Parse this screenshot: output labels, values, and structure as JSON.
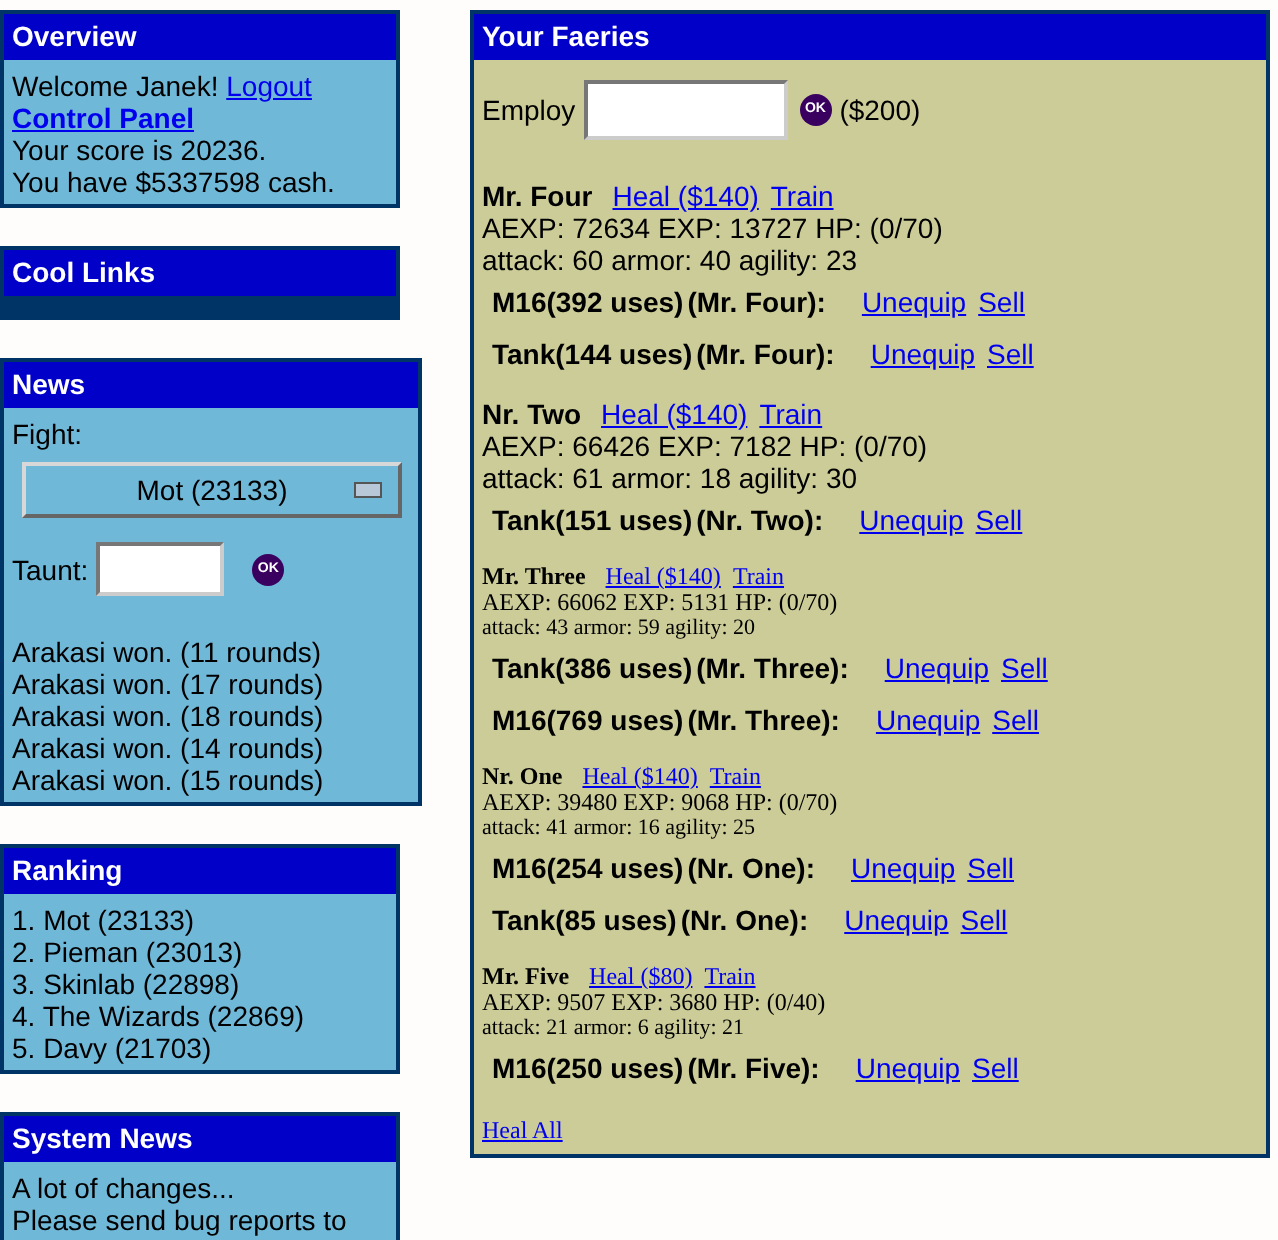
{
  "overview": {
    "title": "Overview",
    "welcome": "Welcome Janek!",
    "logout": "Logout",
    "control_panel": "Control Panel",
    "score": "Your score is 20236.",
    "cash": "You have $5337598 cash."
  },
  "cool_links": {
    "title": "Cool Links"
  },
  "news": {
    "title": "News",
    "fight_label": "Fight:",
    "fight_select": "Mot (23133)",
    "taunt_label": "Taunt:",
    "ok": "OK",
    "results": [
      "Arakasi won. (11 rounds)",
      "Arakasi won. (17 rounds)",
      "Arakasi won. (18 rounds)",
      "Arakasi won. (14 rounds)",
      "Arakasi won. (15 rounds)"
    ]
  },
  "ranking": {
    "title": "Ranking",
    "items": [
      "1. Mot (23133)",
      "2. Pieman (23013)",
      "3. Skinlab (22898)",
      "4. The Wizards (22869)",
      "5. Davy (21703)"
    ]
  },
  "system_news": {
    "title": "System News",
    "lines": [
      "A lot of changes...",
      "Please send bug reports to"
    ]
  },
  "faeries": {
    "title": "Your Faeries",
    "employ_label": "Employ",
    "ok": "OK",
    "employ_cost": "($200)",
    "items": [
      {
        "kind": "large",
        "name": "Mr. Four",
        "heal": "Heal ($140)",
        "train": "Train",
        "stats": "AEXP: 72634 EXP: 13727 HP: (0/70)",
        "attributes": "attack: 60 armor: 40 agility: 23",
        "equipment": [
          {
            "item": "M16(392 uses)",
            "owner": "(Mr. Four):",
            "unequip": "Unequip",
            "sell": "Sell"
          },
          {
            "item": "Tank(144 uses)",
            "owner": "(Mr. Four):",
            "unequip": "Unequip",
            "sell": "Sell"
          }
        ]
      },
      {
        "kind": "large",
        "name": "Nr. Two",
        "heal": "Heal ($140)",
        "train": "Train",
        "stats": "AEXP: 66426 EXP: 7182 HP: (0/70)",
        "attributes": "attack: 61 armor: 18 agility: 30",
        "equipment": [
          {
            "item": "Tank(151 uses)",
            "owner": "(Nr. Two):",
            "unequip": "Unequip",
            "sell": "Sell"
          }
        ]
      },
      {
        "kind": "small",
        "name": "Mr. Three",
        "heal": "Heal ($140)",
        "train": "Train",
        "stats": "AEXP: 66062 EXP: 5131 HP: (0/70)",
        "attributes": "attack: 43 armor: 59 agility: 20",
        "equipment": [
          {
            "item": "Tank(386 uses)",
            "owner": "(Mr. Three):",
            "unequip": "Unequip",
            "sell": "Sell"
          },
          {
            "item": "M16(769 uses)",
            "owner": "(Mr. Three):",
            "unequip": "Unequip",
            "sell": "Sell"
          }
        ]
      },
      {
        "kind": "small",
        "name": "Nr. One",
        "heal": "Heal ($140)",
        "train": "Train",
        "stats": "AEXP: 39480 EXP: 9068 HP: (0/70)",
        "attributes": "attack: 41 armor: 16 agility: 25",
        "equipment": [
          {
            "item": "M16(254 uses)",
            "owner": "(Nr. One):",
            "unequip": "Unequip",
            "sell": "Sell"
          },
          {
            "item": "Tank(85 uses)",
            "owner": "(Nr. One):",
            "unequip": "Unequip",
            "sell": "Sell"
          }
        ]
      },
      {
        "kind": "small",
        "name": "Mr. Five",
        "heal": "Heal ($80)",
        "train": "Train",
        "stats": "AEXP: 9507 EXP: 3680 HP: (0/40)",
        "attributes": "attack: 21 armor: 6 agility: 21",
        "equipment": [
          {
            "item": "M16(250 uses)",
            "owner": "(Mr. Five):",
            "unequip": "Unequip",
            "sell": "Sell"
          }
        ]
      }
    ],
    "heal_all": "Heal All"
  }
}
